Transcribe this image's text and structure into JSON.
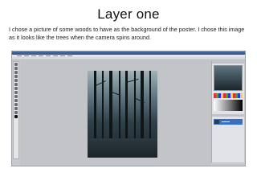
{
  "slide": {
    "title": "Layer one",
    "body": "I chose a picture of some woods to have as the background of the poster. I chose this image as it looks like the trees when the camera spins around."
  },
  "screenshot": {
    "app": "photoshop",
    "document_image": "dark-forest-photo"
  }
}
